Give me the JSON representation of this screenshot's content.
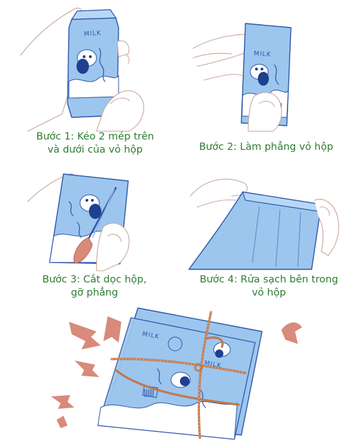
{
  "steps": [
    {
      "line1": "Bước 1: Kéo 2 mép trên",
      "line2": "và dưới của vỏ hộp"
    },
    {
      "line1": "Bước 2: Làm phẳng vỏ hộp",
      "line2": ""
    },
    {
      "line1": "Bước 3: Cắt dọc hộp,",
      "line2": "gỡ phẳng"
    },
    {
      "line1": "Bước 4: Rửa sạch bên trong",
      "line2": "vỏ hộp"
    }
  ],
  "carton_label": "MILK",
  "colors": {
    "caption": "#2e7d32",
    "carton_fill": "#9cc6ee",
    "carton_outline": "#2f56a8",
    "accent_arrows": "#d98a7a",
    "rope": "#c0784f"
  }
}
